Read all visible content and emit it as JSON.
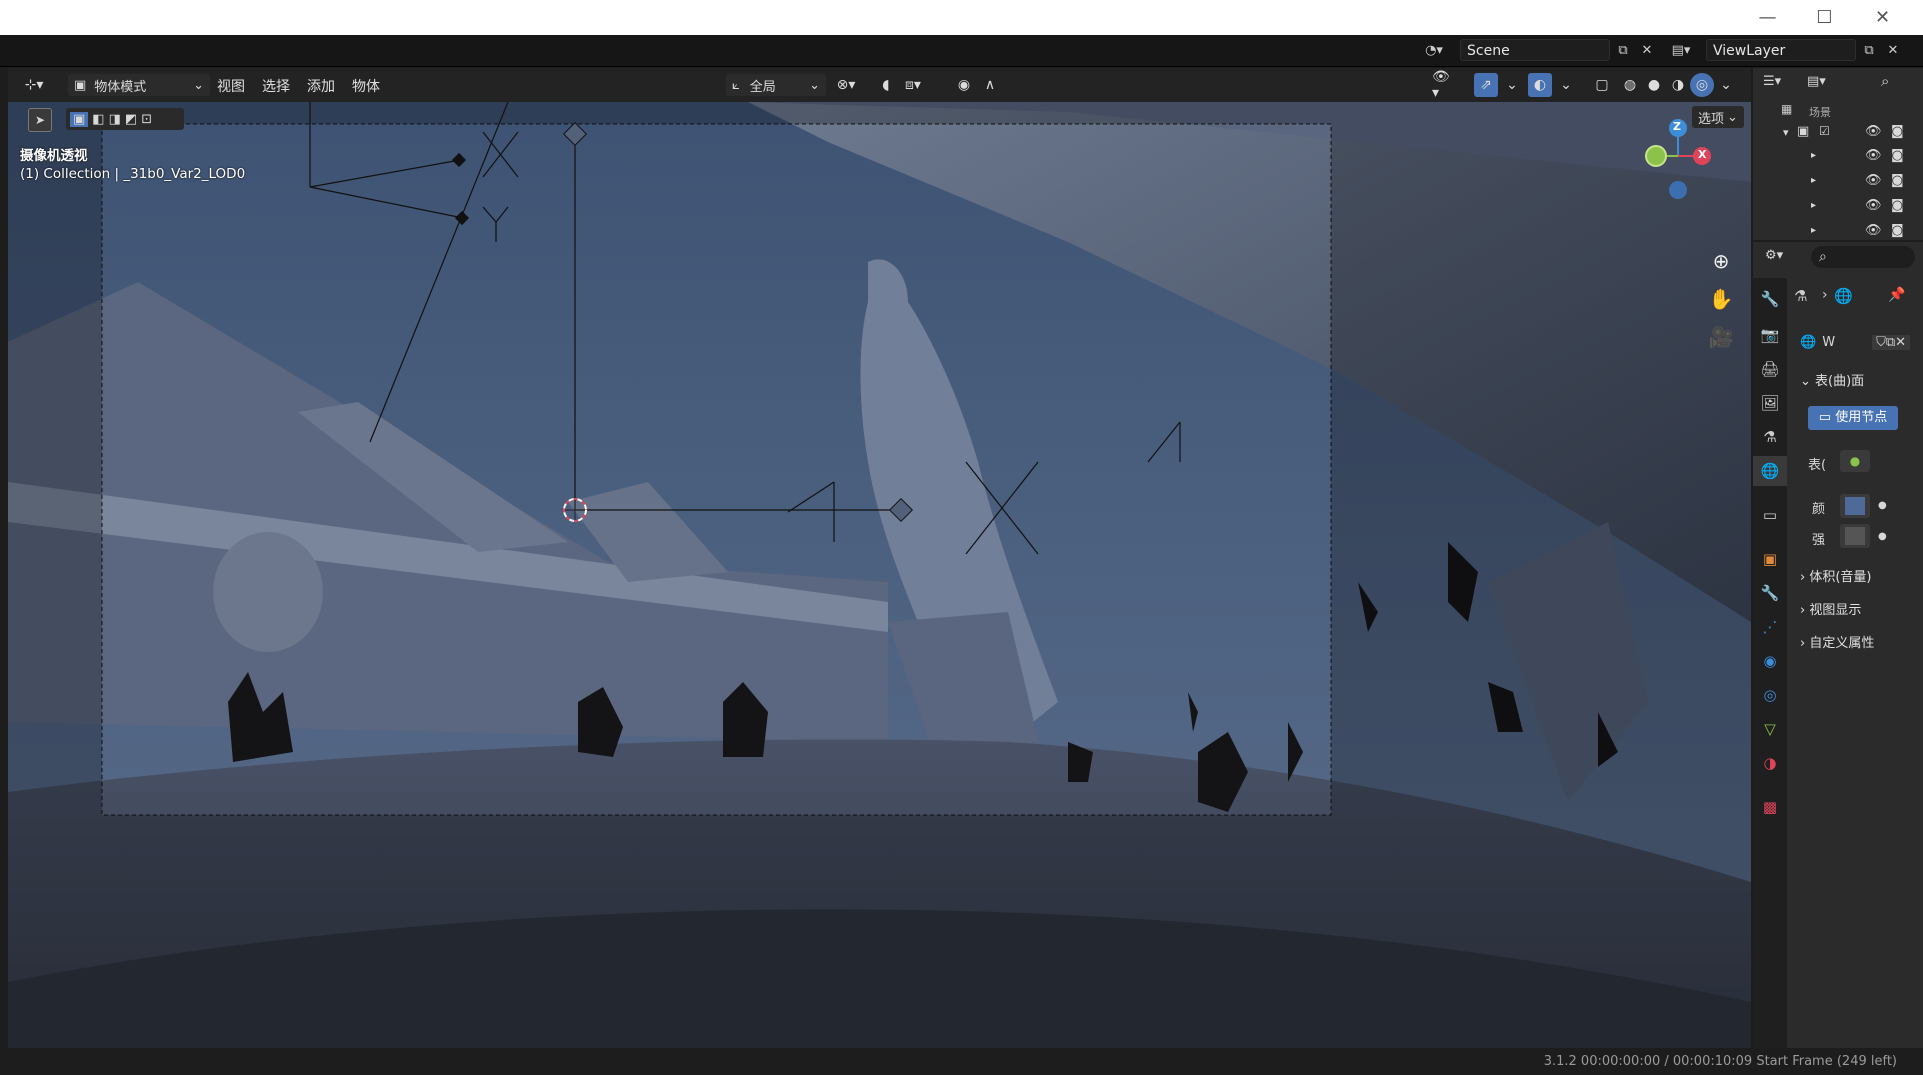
{
  "window": {
    "minimize_glyph": "—",
    "maximize_glyph": "☐",
    "close_glyph": "✕"
  },
  "topbar": {
    "scene_label": "Scene",
    "viewlayer_label": "ViewLayer"
  },
  "viewport_header": {
    "mode_label": "物体模式",
    "menus": [
      "视图",
      "选择",
      "添加",
      "物体"
    ],
    "transform_orientation": "全局",
    "options_label": "选项"
  },
  "viewport": {
    "camera_view_label": "摄像机透视",
    "collection_label": "(1) Collection | _31b0_Var2_LOD0",
    "gizmo_axes": {
      "z": "Z",
      "x": "X"
    },
    "empty_labels": [
      "X",
      "Y"
    ]
  },
  "outliner": {
    "root_label": "场景"
  },
  "properties": {
    "world_name": "W",
    "surface_panel": "表(曲)面",
    "use_nodes_button": "使用节点",
    "surface_field": "表(",
    "color_field": "颜",
    "strength_field": "强",
    "volume_panel": "体积(音量)",
    "viewport_display_panel": "视图显示",
    "custom_props_panel": "自定义属性"
  },
  "statusbar": {
    "text": "3.1.2  00:00:00:00 / 00:00:10:09  Start Frame (249 left)"
  },
  "colors": {
    "accent_blue": "#4772b3",
    "axis_x": "#e0445a",
    "axis_y": "#8bc34a",
    "axis_z": "#3c8ed8",
    "sky": "#4a5c78",
    "ground": "#3e4656"
  }
}
